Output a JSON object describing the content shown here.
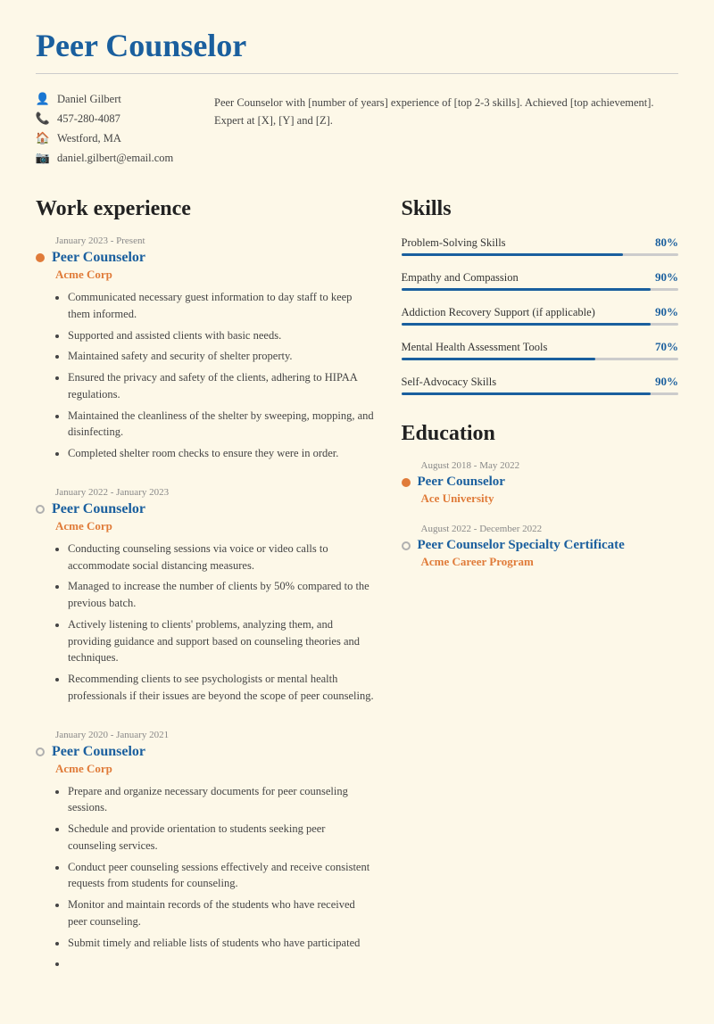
{
  "header": {
    "title": "Peer Counselor",
    "contact": {
      "name": "Daniel Gilbert",
      "phone": "457-280-4087",
      "location": "Westford, MA",
      "email": "daniel.gilbert@email.com"
    },
    "summary": "Peer Counselor with [number of years] experience of [top 2-3 skills]. Achieved [top achievement]. Expert at [X], [Y] and [Z]."
  },
  "work_experience": {
    "section_title": "Work experience",
    "jobs": [
      {
        "date": "January 2023 - Present",
        "title": "Peer Counselor",
        "company": "Acme Corp",
        "bullet_type": "filled",
        "bullets": [
          "Communicated necessary guest information to day staff to keep them informed.",
          "Supported and assisted clients with basic needs.",
          "Maintained safety and security of shelter property.",
          "Ensured the privacy and safety of the clients, adhering to HIPAA regulations.",
          "Maintained the cleanliness of the shelter by sweeping, mopping, and disinfecting.",
          "Completed shelter room checks to ensure they were in order."
        ]
      },
      {
        "date": "January 2022 - January 2023",
        "title": "Peer Counselor",
        "company": "Acme Corp",
        "bullet_type": "outlined",
        "bullets": [
          "Conducting counseling sessions via voice or video calls to accommodate social distancing measures.",
          "Managed to increase the number of clients by 50% compared to the previous batch.",
          "Actively listening to clients' problems, analyzing them, and providing guidance and support based on counseling theories and techniques.",
          "Recommending clients to see psychologists or mental health professionals if their issues are beyond the scope of peer counseling."
        ]
      },
      {
        "date": "January 2020 - January 2021",
        "title": "Peer Counselor",
        "company": "Acme Corp",
        "bullet_type": "outlined",
        "bullets": [
          "Prepare and organize necessary documents for peer counseling sessions.",
          "Schedule and provide orientation to students seeking peer counseling services.",
          "Conduct peer counseling sessions effectively and receive consistent requests from students for counseling.",
          "Monitor and maintain records of the students who have received peer counseling.",
          "Submit timely and reliable lists of students who have participated"
        ]
      }
    ]
  },
  "skills": {
    "section_title": "Skills",
    "items": [
      {
        "name": "Problem-Solving Skills",
        "percent": 80,
        "label": "80%"
      },
      {
        "name": "Empathy and Compassion",
        "percent": 90,
        "label": "90%"
      },
      {
        "name": "Addiction Recovery Support (if applicable)",
        "percent": 90,
        "label": "90%"
      },
      {
        "name": "Mental Health Assessment Tools",
        "percent": 70,
        "label": "70%"
      },
      {
        "name": "Self-Advocacy Skills",
        "percent": 90,
        "label": "90%"
      }
    ]
  },
  "education": {
    "section_title": "Education",
    "items": [
      {
        "date": "August 2018 - May 2022",
        "title": "Peer Counselor",
        "institution": "Ace University",
        "bullet_type": "filled"
      },
      {
        "date": "August 2022 - December 2022",
        "title": "Peer Counselor Specialty Certificate",
        "institution": "Acme Career Program",
        "bullet_type": "outlined"
      }
    ]
  },
  "icons": {
    "person": "👤",
    "phone": "📞",
    "location": "🏠",
    "email": "📧"
  }
}
